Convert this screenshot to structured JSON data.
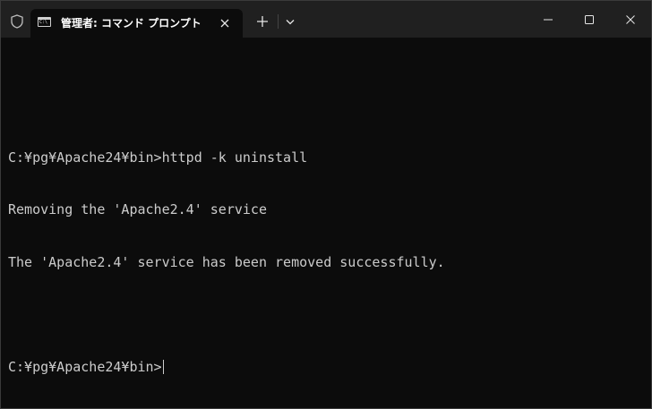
{
  "window": {
    "tab_title": "管理者: コマンド プロンプト",
    "tab_icon_glyph": "C:\\",
    "icons": {
      "shield": "shield-icon",
      "close_tab": "close-icon",
      "new_tab": "plus-icon",
      "dropdown": "chevron-down-icon",
      "minimize": "minimize-icon",
      "maximize": "maximize-icon",
      "close_window": "close-icon"
    }
  },
  "terminal": {
    "lines": [
      "",
      "C:¥pg¥Apache24¥bin>httpd -k uninstall",
      "Removing the 'Apache2.4' service",
      "The 'Apache2.4' service has been removed successfully.",
      "",
      "C:¥pg¥Apache24¥bin>"
    ]
  },
  "colors": {
    "background": "#0c0c0c",
    "titlebar": "#202020",
    "text": "#cccccc"
  }
}
